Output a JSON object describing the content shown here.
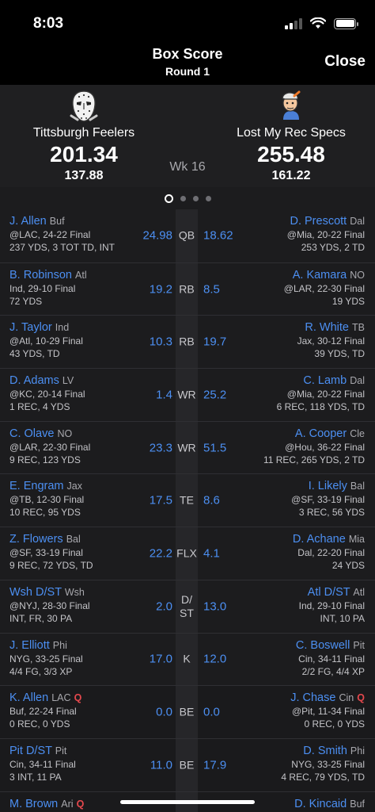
{
  "status": {
    "time": "8:03"
  },
  "nav": {
    "title": "Box Score",
    "subtitle": "Round 1",
    "close": "Close"
  },
  "matchup": {
    "week": "Wk 16",
    "left": {
      "name": "Tittsburgh Feelers",
      "score": "201.34",
      "projected": "137.88",
      "avatar": "hockey-mask-icon"
    },
    "right": {
      "name": "Lost My Rec Specs",
      "score": "255.48",
      "projected": "161.22",
      "avatar": "cartoon-guy-icon"
    }
  },
  "pager": {
    "pages": 4,
    "active": 0
  },
  "rows": [
    {
      "slot": "QB",
      "left": {
        "name": "J. Allen",
        "team": "Buf",
        "game": "@LAC, 24-22 Final",
        "stats": "237 YDS, 3 TOT TD, INT",
        "pts": "24.98"
      },
      "right": {
        "name": "D. Prescott",
        "team": "Dal",
        "game": "@Mia, 20-22 Final",
        "stats": "253 YDS, 2 TD",
        "pts": "18.62"
      }
    },
    {
      "slot": "RB",
      "left": {
        "name": "B. Robinson",
        "team": "Atl",
        "game": "Ind, 29-10 Final",
        "stats": "72 YDS",
        "pts": "19.2"
      },
      "right": {
        "name": "A. Kamara",
        "team": "NO",
        "game": "@LAR, 22-30 Final",
        "stats": "19 YDS",
        "pts": "8.5"
      }
    },
    {
      "slot": "RB",
      "left": {
        "name": "J. Taylor",
        "team": "Ind",
        "game": "@Atl, 10-29 Final",
        "stats": "43 YDS, TD",
        "pts": "10.3"
      },
      "right": {
        "name": "R. White",
        "team": "TB",
        "game": "Jax, 30-12 Final",
        "stats": "39 YDS, TD",
        "pts": "19.7"
      }
    },
    {
      "slot": "WR",
      "left": {
        "name": "D. Adams",
        "team": "LV",
        "game": "@KC, 20-14 Final",
        "stats": "1 REC, 4 YDS",
        "pts": "1.4"
      },
      "right": {
        "name": "C. Lamb",
        "team": "Dal",
        "game": "@Mia, 20-22 Final",
        "stats": "6 REC, 118 YDS, TD",
        "pts": "25.2"
      }
    },
    {
      "slot": "WR",
      "left": {
        "name": "C. Olave",
        "team": "NO",
        "game": "@LAR, 22-30 Final",
        "stats": "9 REC, 123 YDS",
        "pts": "23.3"
      },
      "right": {
        "name": "A. Cooper",
        "team": "Cle",
        "game": "@Hou, 36-22 Final",
        "stats": "11 REC, 265 YDS, 2 TD",
        "pts": "51.5"
      }
    },
    {
      "slot": "TE",
      "left": {
        "name": "E. Engram",
        "team": "Jax",
        "game": "@TB, 12-30 Final",
        "stats": "10 REC, 95 YDS",
        "pts": "17.5"
      },
      "right": {
        "name": "I. Likely",
        "team": "Bal",
        "game": "@SF, 33-19 Final",
        "stats": "3 REC, 56 YDS",
        "pts": "8.6"
      }
    },
    {
      "slot": "FLX",
      "left": {
        "name": "Z. Flowers",
        "team": "Bal",
        "game": "@SF, 33-19 Final",
        "stats": "9 REC, 72 YDS, TD",
        "pts": "22.2"
      },
      "right": {
        "name": "D. Achane",
        "team": "Mia",
        "game": "Dal, 22-20 Final",
        "stats": "24 YDS",
        "pts": "4.1"
      }
    },
    {
      "slot": "D/\nST",
      "left": {
        "name": "Wsh D/ST",
        "team": "Wsh",
        "game": "@NYJ, 28-30 Final",
        "stats": "INT, FR, 30 PA",
        "pts": "2.0"
      },
      "right": {
        "name": "Atl D/ST",
        "team": "Atl",
        "game": "Ind, 29-10 Final",
        "stats": "INT, 10 PA",
        "pts": "13.0"
      }
    },
    {
      "slot": "K",
      "left": {
        "name": "J. Elliott",
        "team": "Phi",
        "game": "NYG, 33-25 Final",
        "stats": "4/4 FG, 3/3 XP",
        "pts": "17.0"
      },
      "right": {
        "name": "C. Boswell",
        "team": "Pit",
        "game": "Cin, 34-11 Final",
        "stats": "2/2 FG, 4/4 XP",
        "pts": "12.0"
      }
    },
    {
      "slot": "BE",
      "bench": true,
      "left": {
        "name": "K. Allen",
        "team": "LAC",
        "q": "Q",
        "game": "Buf, 22-24 Final",
        "stats": "0 REC, 0 YDS",
        "pts": "0.0"
      },
      "right": {
        "name": "J. Chase",
        "team": "Cin",
        "q": "Q",
        "game": "@Pit, 11-34 Final",
        "stats": "0 REC, 0 YDS",
        "pts": "0.0"
      }
    },
    {
      "slot": "BE",
      "bench": true,
      "left": {
        "name": "Pit D/ST",
        "team": "Pit",
        "game": "Cin, 34-11 Final",
        "stats": "3 INT, 11 PA",
        "pts": "11.0"
      },
      "right": {
        "name": "D. Smith",
        "team": "Phi",
        "game": "NYG, 33-25 Final",
        "stats": "4 REC, 79 YDS, TD",
        "pts": "17.9"
      }
    },
    {
      "slot": "",
      "bench": true,
      "partial": true,
      "left": {
        "name": "M. Brown",
        "team": "Ari",
        "q": "Q",
        "game": "",
        "stats": "",
        "pts": ""
      },
      "right": {
        "name": "D. Kincaid",
        "team": "Buf",
        "game": "",
        "stats": "",
        "pts": ""
      }
    }
  ]
}
